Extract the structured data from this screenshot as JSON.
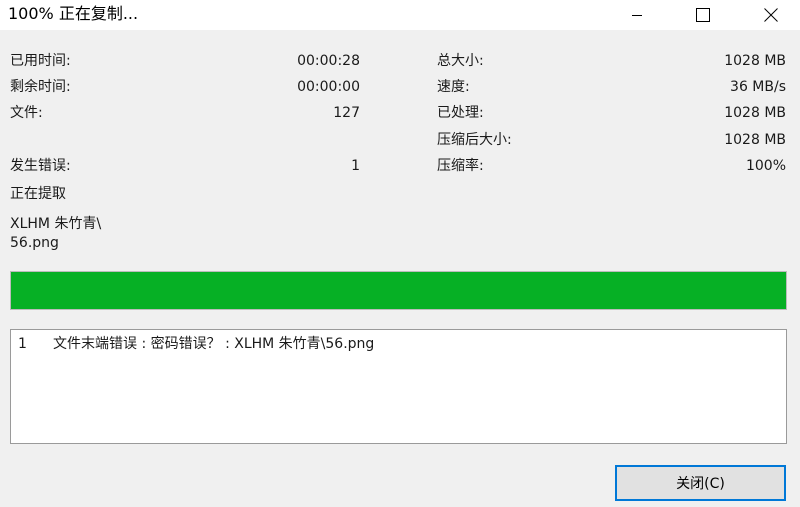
{
  "window": {
    "title": "100% 正在复制...",
    "controls": {
      "minimize_icon": "minimize-icon",
      "maximize_icon": "maximize-icon",
      "close_icon": "close-icon"
    }
  },
  "stats": {
    "elapsed_label": "已用时间:",
    "elapsed_value": "00:00:28",
    "remaining_label": "剩余时间:",
    "remaining_value": "00:00:00",
    "files_label": "文件:",
    "files_value": "127",
    "errors_label": "发生错误:",
    "errors_value": "1",
    "total_size_label": "总大小:",
    "total_size_value": "1028 MB",
    "speed_label": "速度:",
    "speed_value": "36 MB/s",
    "processed_label": "已处理:",
    "processed_value": "1028 MB",
    "compressed_size_label": "压缩后大小:",
    "compressed_size_value": "1028 MB",
    "ratio_label": "压缩率:",
    "ratio_value": "100%"
  },
  "status": {
    "label": "正在提取",
    "current_file_dir": "XLHM 朱竹青\\",
    "current_file_name": "56.png"
  },
  "progress": {
    "percent": 100,
    "color": "#06b025"
  },
  "errors": [
    {
      "num": "1",
      "message": "文件末端错误 : 密码错误？ : XLHM 朱竹青\\56.png"
    }
  ],
  "footer": {
    "close_label": "关闭(C)",
    "accent_color": "#0078d7"
  }
}
